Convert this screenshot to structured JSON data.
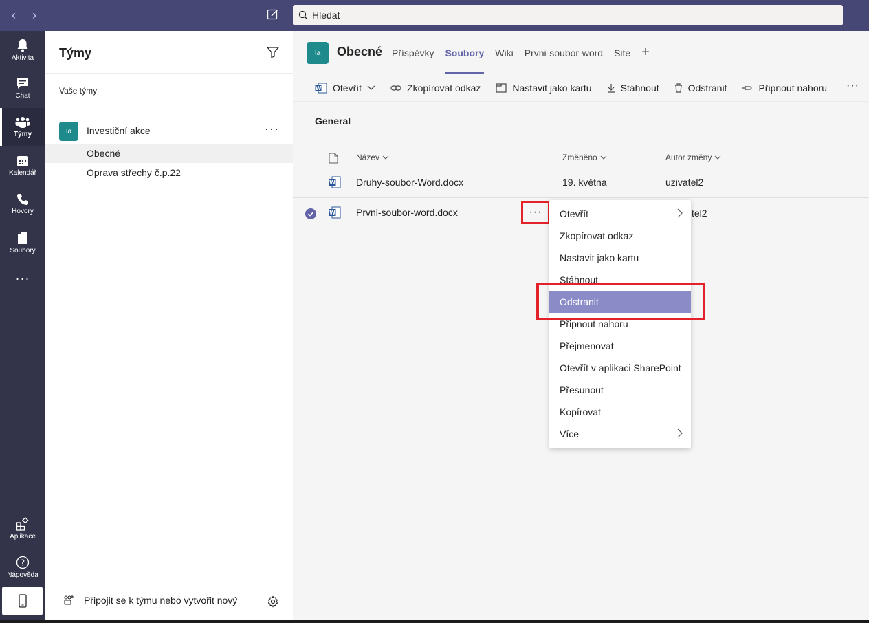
{
  "search": {
    "placeholder": "Hledat"
  },
  "rail": {
    "items": [
      {
        "label": "Aktivita",
        "icon": "bell-icon"
      },
      {
        "label": "Chat",
        "icon": "chat-icon"
      },
      {
        "label": "Týmy",
        "icon": "teams-icon"
      },
      {
        "label": "Kalendář",
        "icon": "calendar-icon"
      },
      {
        "label": "Hovory",
        "icon": "phone-icon"
      },
      {
        "label": "Soubory",
        "icon": "file-icon"
      }
    ],
    "more": "···",
    "apps_label": "Aplikace",
    "help_label": "Nápověda"
  },
  "teams_panel": {
    "title": "Týmy",
    "subtitle": "Vaše týmy",
    "team": {
      "avatar": "Ia",
      "name": "Investiční akce",
      "more": "···"
    },
    "channels": [
      "Obecné",
      "Oprava střechy č.p.22"
    ],
    "join_label": "Připojit se k týmu nebo vytvořit nový"
  },
  "channel": {
    "avatar": "Ia",
    "title": "Obecné",
    "tabs": [
      "Příspěvky",
      "Soubory",
      "Wiki",
      "Prvni-soubor-word",
      "Site"
    ],
    "add_tab": "+"
  },
  "toolbar": {
    "open": "Otevřít",
    "copy_link": "Zkopírovat odkaz",
    "set_tab": "Nastavit jako kartu",
    "download": "Stáhnout",
    "delete": "Odstranit",
    "pin": "Připnout nahoru",
    "more": "···"
  },
  "files": {
    "folder": "General",
    "columns": {
      "name": "Název",
      "modified": "Změněno",
      "author": "Autor změny"
    },
    "rows": [
      {
        "name": "Druhy-soubor-Word.docx",
        "modified": "19. května",
        "author": "uzivatel2"
      },
      {
        "name": "Prvni-soubor-word.docx",
        "modified": "",
        "author": "tel2"
      }
    ],
    "row_more": "···"
  },
  "context_menu": {
    "items": [
      "Otevřít",
      "Zkopírovat odkaz",
      "Nastavit jako kartu",
      "Stáhnout",
      "Odstranit",
      "Připnout nahoru",
      "Přejmenovat",
      "Otevřít v aplikaci SharePoint",
      "Přesunout",
      "Kopírovat",
      "Více"
    ],
    "highlighted": "Odstranit"
  },
  "colors": {
    "accent": "#6264a7",
    "topbar": "#464775",
    "rail": "#33344a",
    "highlight_box": "#e32129",
    "team_avatar": "#1e8a8c"
  }
}
